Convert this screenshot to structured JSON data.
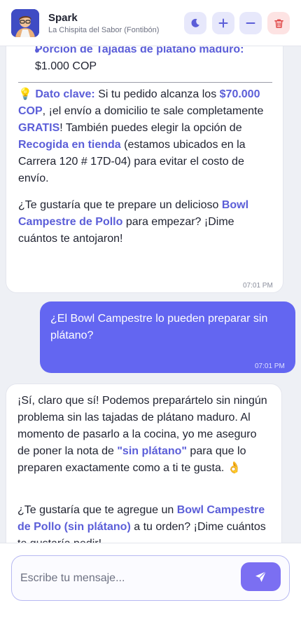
{
  "header": {
    "title": "Spark",
    "subtitle": "La Chispita del Sabor (Fontibón)",
    "icons": [
      "moon-icon",
      "plus-icon",
      "minus-icon",
      "trash-icon"
    ]
  },
  "messages": {
    "m1": {
      "bullet_label": "Porción de Tajadas de plátano maduro:",
      "bullet_price": "$1.000 COP",
      "tip_emoji": "💡",
      "tip_label": "Dato clave:",
      "tip_t1": " Si tu pedido alcanza los ",
      "tip_amount": "$70.000 COP",
      "tip_t2": ", ¡el envío a domicilio te sale completamente ",
      "tip_free": "GRATIS",
      "tip_t3": "! También puedes elegir la opción de ",
      "tip_store": "Recogida en tienda",
      "tip_t4": " (estamos ubicados en la Carrera 120 # 17D-04) para evitar el costo de envío.",
      "q_t1": "¿Te gustaría que te prepare un delicioso ",
      "q_item": "Bowl Campestre de Pollo",
      "q_t2": " para empezar? ¡Dime cuántos te antojaron!",
      "time": "07:01 PM"
    },
    "m2": {
      "text": "¿El Bowl Campestre lo pueden preparar sin plátano?",
      "time": "07:01 PM"
    },
    "m3": {
      "p1_t1": "¡Sí, claro que sí! Podemos preparártelo sin ningún problema sin las tajadas de plátano maduro. Al momento de pasarlo a la cocina, yo me aseguro de poner la nota de ",
      "p1_note": "\"sin plátano\"",
      "p1_t2": " para que lo preparen exactamente como a ti te gusta. 👌",
      "p2_t1": "¿Te gustaría que te agregue un ",
      "p2_item": "Bowl Campestre de Pollo (sin plátano)",
      "p2_t2": " a tu orden? ¡Dime cuántos te gustaría pedir!"
    }
  },
  "composer": {
    "placeholder": "Escribe tu mensaje..."
  },
  "colors": {
    "accent": "#6366f1",
    "highlight": "#5b5ed8",
    "danger": "#e04848",
    "send": "#7b6ff2"
  }
}
